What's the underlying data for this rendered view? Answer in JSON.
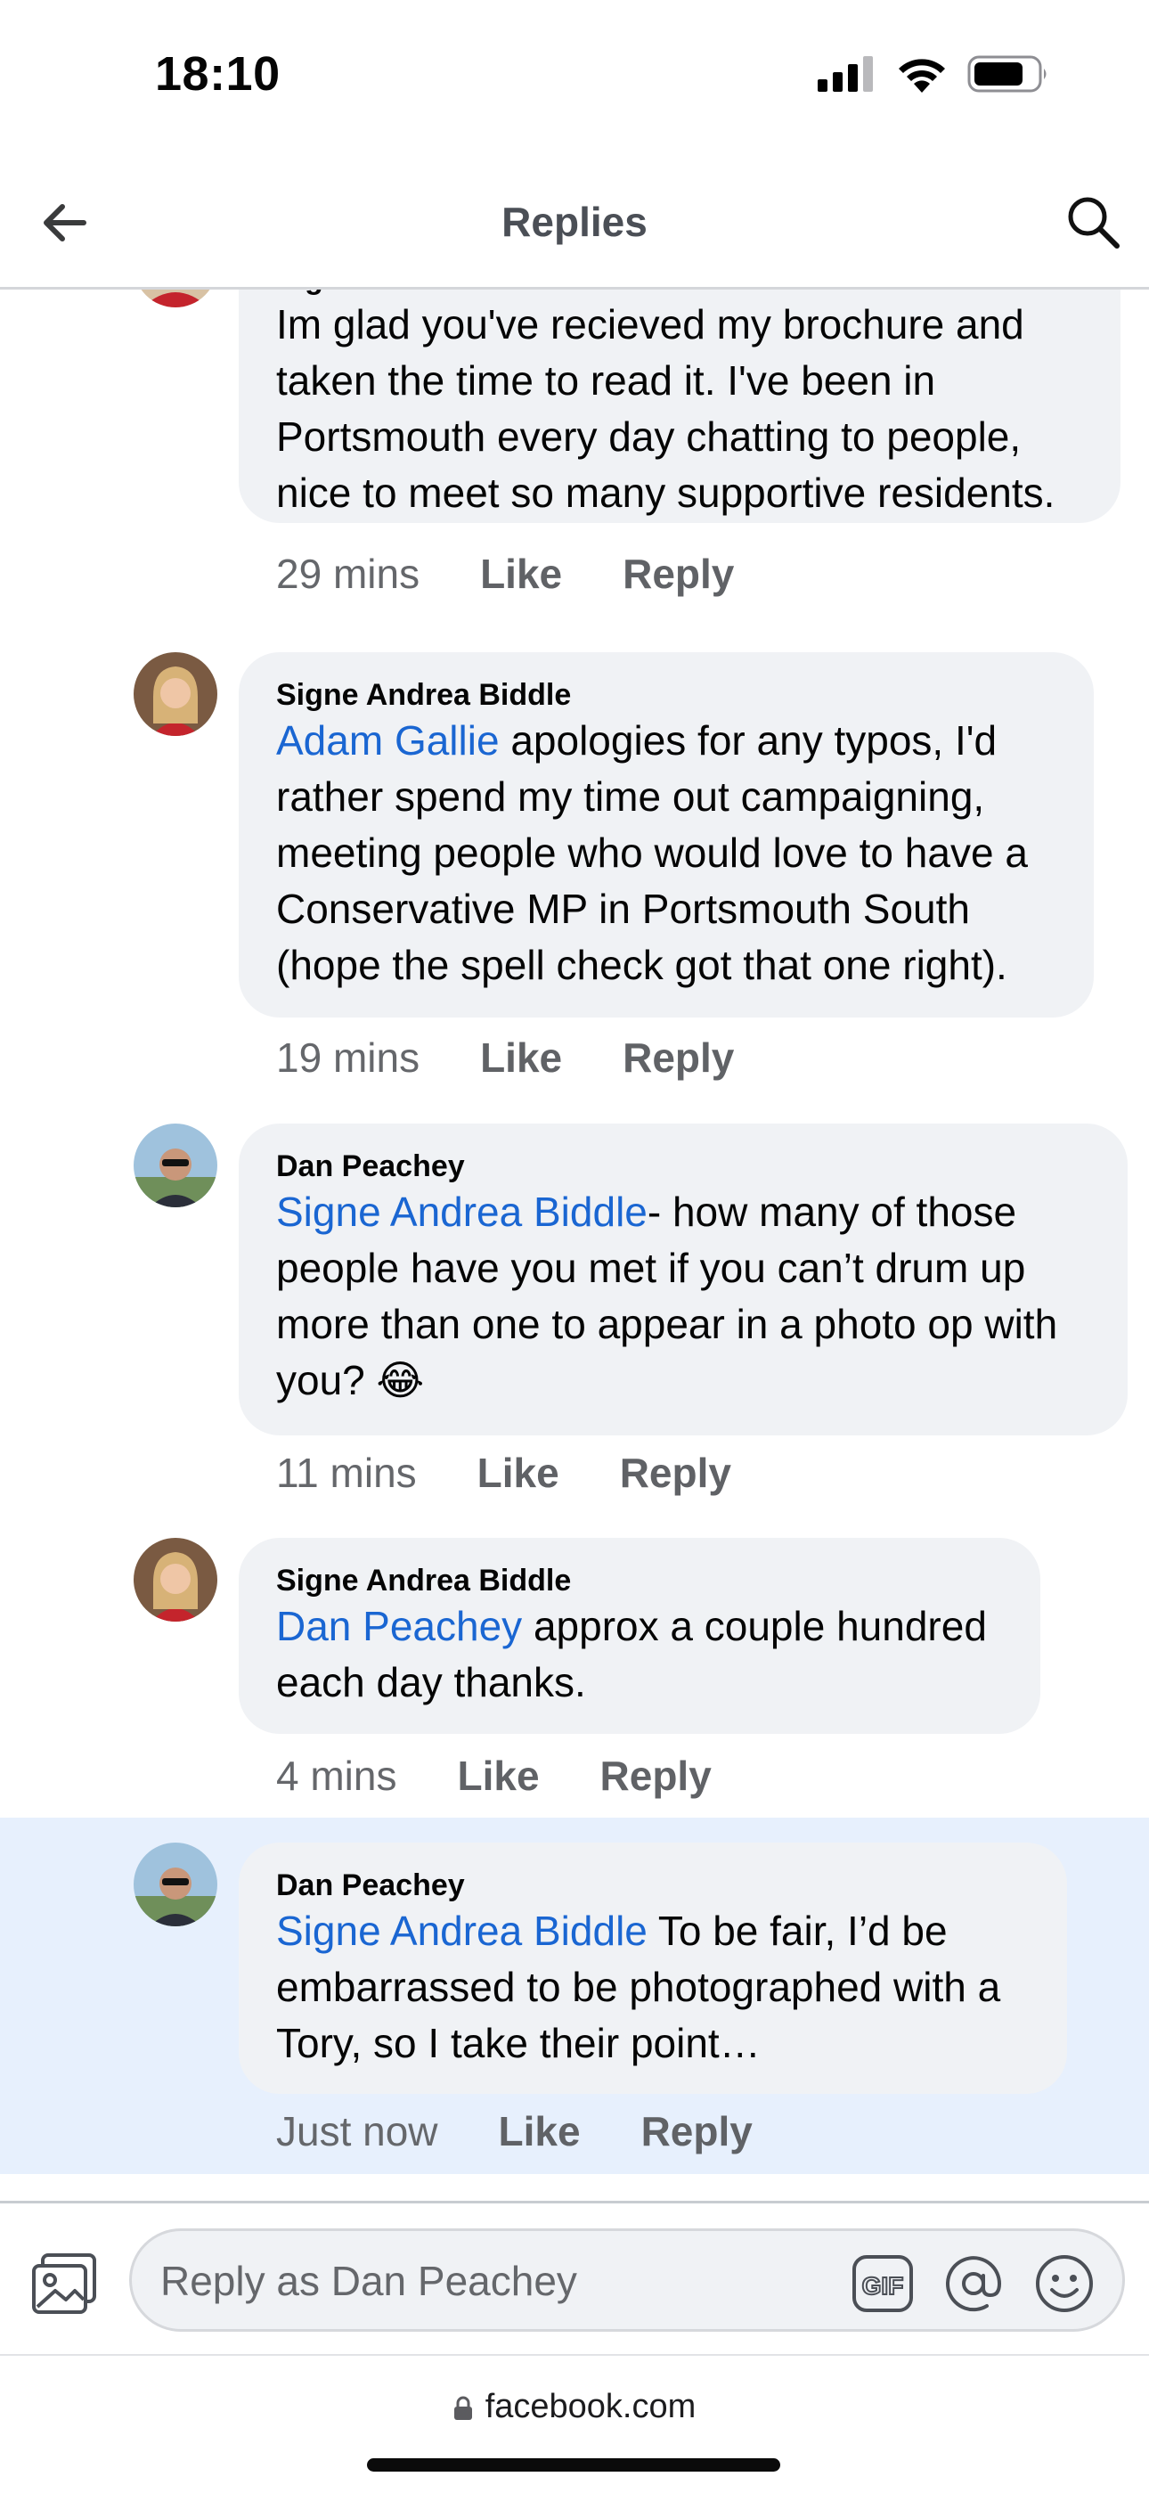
{
  "status_bar": {
    "time": "18:10"
  },
  "header": {
    "title": "Replies"
  },
  "comments": [
    {
      "name": "Signe Andrea Biddle",
      "mention": "",
      "text": "Im glad you've recieved my brochure and taken the time to read it. I've been in Portsmouth every day chatting to people, nice to meet so many supportive residents.",
      "time": "29 mins",
      "like": "Like",
      "reply": "Reply"
    },
    {
      "name": "Signe Andrea Biddle",
      "mention": "Adam Gallie",
      "text": " apologies for any typos, I'd rather spend my time out campaigning, meeting people who would love to have a Conservative MP in Portsmouth South (hope the spell check got that one right).",
      "time": "19 mins",
      "like": "Like",
      "reply": "Reply"
    },
    {
      "name": "Dan Peachey",
      "mention": "Signe Andrea Biddle",
      "text": "- how many of those people have you met if you can’t drum up more than one to appear in a photo op with you? 😂",
      "time": "11 mins",
      "like": "Like",
      "reply": "Reply"
    },
    {
      "name": "Signe Andrea Biddle",
      "mention": "Dan Peachey",
      "text": " approx a couple hundred each day thanks.",
      "time": "4 mins",
      "like": "Like",
      "reply": "Reply"
    },
    {
      "name": "Dan Peachey",
      "mention": "Signe Andrea Biddle",
      "text": " To be fair, I’d  be embarrassed to be photographed with a Tory, so I take their point…",
      "time": "Just now",
      "like": "Like",
      "reply": "Reply"
    }
  ],
  "composer": {
    "placeholder": "Reply as Dan Peachey",
    "gif_label": "GIF"
  },
  "url_bar": {
    "domain": "facebook.com"
  }
}
